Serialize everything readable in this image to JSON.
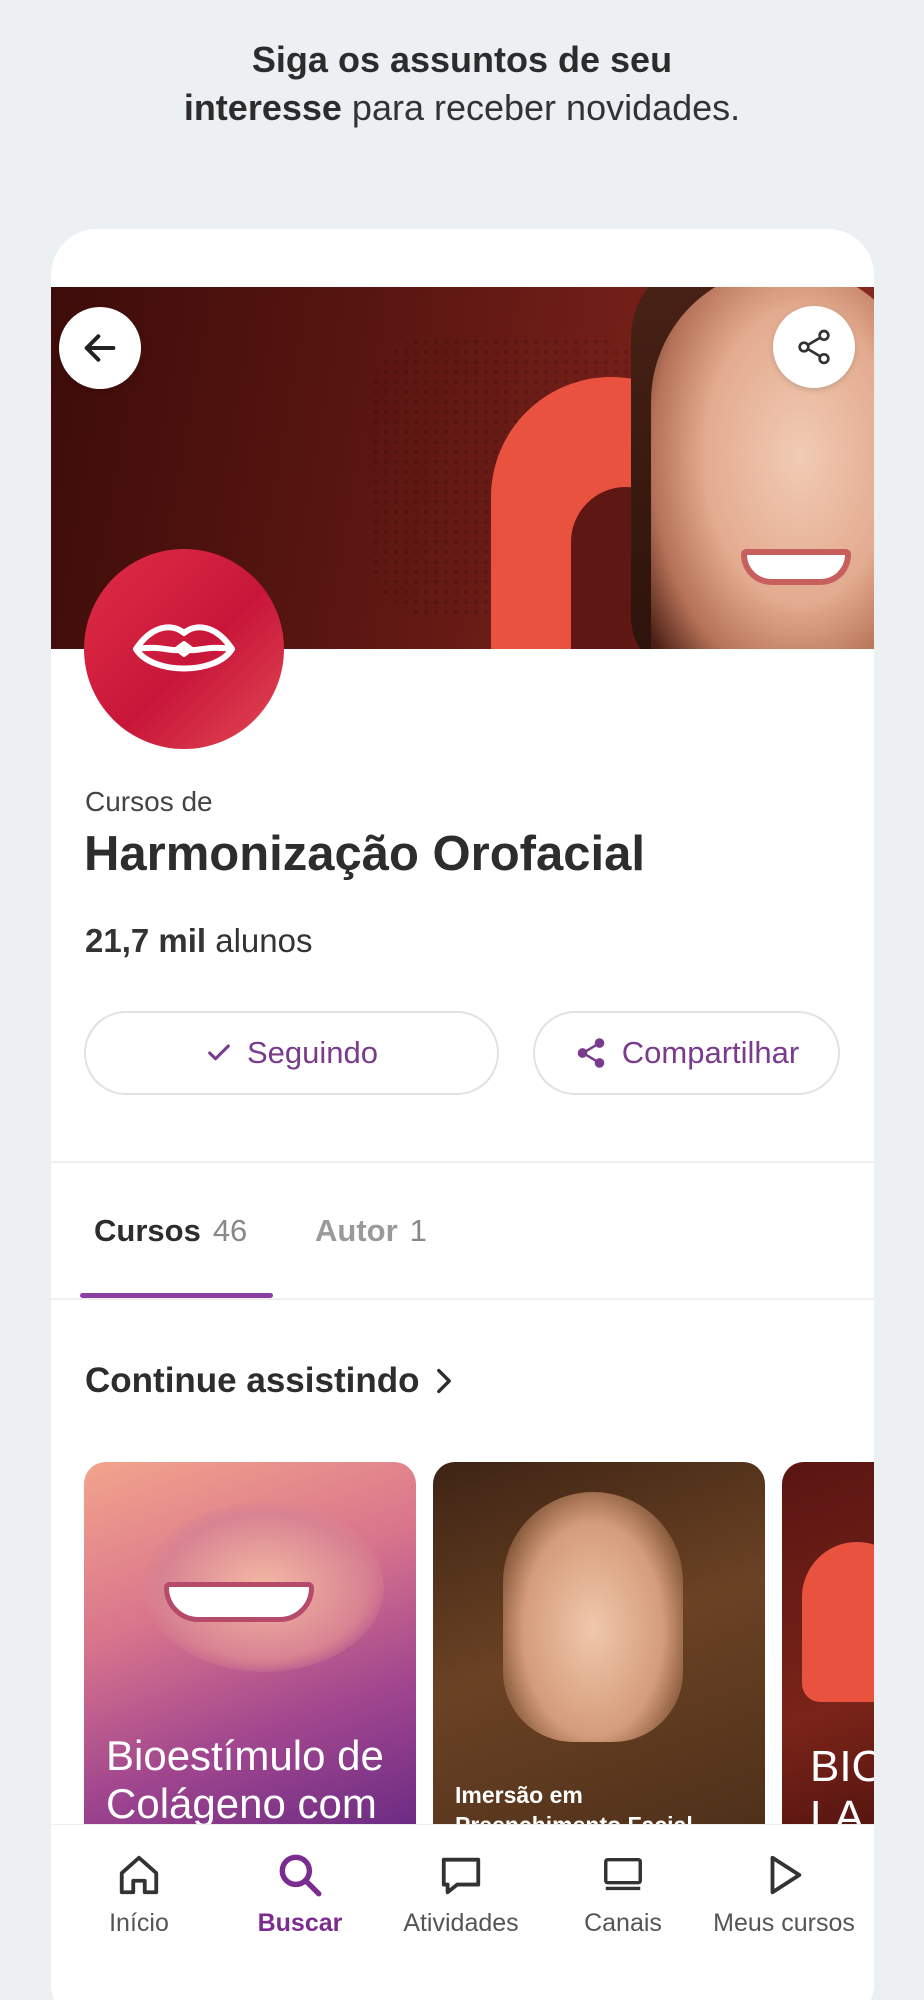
{
  "promo": {
    "line1": "Siga os assuntos de seu",
    "line2_bold": "interesse",
    "line2_rest": " para receber novidades."
  },
  "header": {
    "back_icon": "arrow-left-icon",
    "share_icon": "share-icon"
  },
  "topic": {
    "subtitle": "Cursos de",
    "title": "Harmonização Orofacial",
    "students_count": "21,7 mil",
    "students_label": " alunos",
    "avatar_icon": "lips-icon"
  },
  "actions": {
    "following_label": "Seguindo",
    "share_label": "Compartilhar"
  },
  "tabs": [
    {
      "label": "Cursos",
      "count": "46",
      "active": true
    },
    {
      "label": "Autor",
      "count": "1",
      "active": false
    }
  ],
  "section": {
    "title": "Continue assistindo"
  },
  "cards": [
    {
      "text_line1": "Bioestímulo de",
      "text_line2": "Colágeno com"
    },
    {
      "text_line1": "Imersão em",
      "text_line2": "Preenchimento Facial"
    },
    {
      "text_line1": "BIO",
      "text_line2": "LA"
    }
  ],
  "nav": [
    {
      "label": "Início",
      "icon": "home-icon",
      "active": false
    },
    {
      "label": "Buscar",
      "icon": "search-icon",
      "active": true
    },
    {
      "label": "Atividades",
      "icon": "chat-icon",
      "active": false
    },
    {
      "label": "Canais",
      "icon": "monitor-icon",
      "active": false
    },
    {
      "label": "Meus cursos",
      "icon": "play-icon",
      "active": false
    }
  ],
  "colors": {
    "accent": "#7a2d8f",
    "topic_red": "#d21f3c",
    "background": "#edf0f3"
  }
}
